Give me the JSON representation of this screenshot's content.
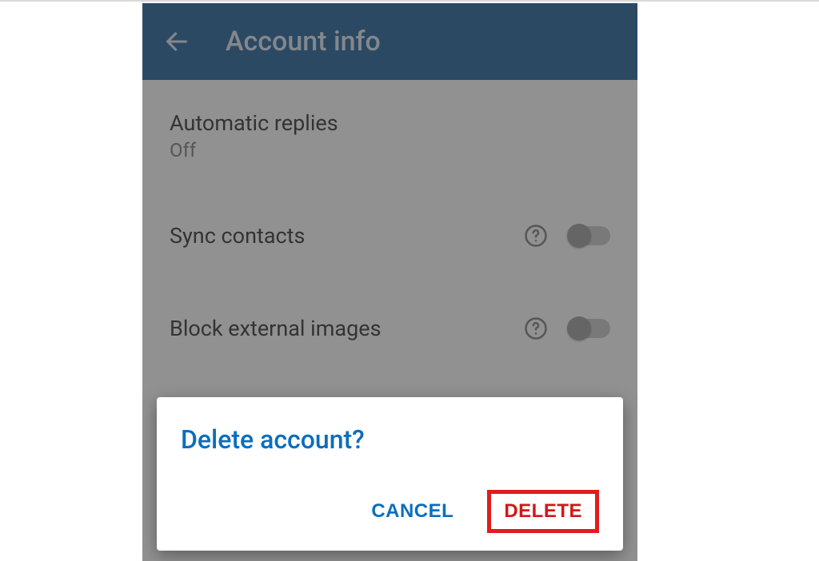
{
  "appbar": {
    "title": "Account info"
  },
  "settings": {
    "auto_replies": {
      "label": "Automatic replies",
      "status": "Off"
    },
    "sync_contacts": {
      "label": "Sync contacts"
    },
    "block_images": {
      "label": "Block external images"
    }
  },
  "dialog": {
    "title": "Delete account?",
    "cancel_label": "CANCEL",
    "delete_label": "DELETE"
  }
}
